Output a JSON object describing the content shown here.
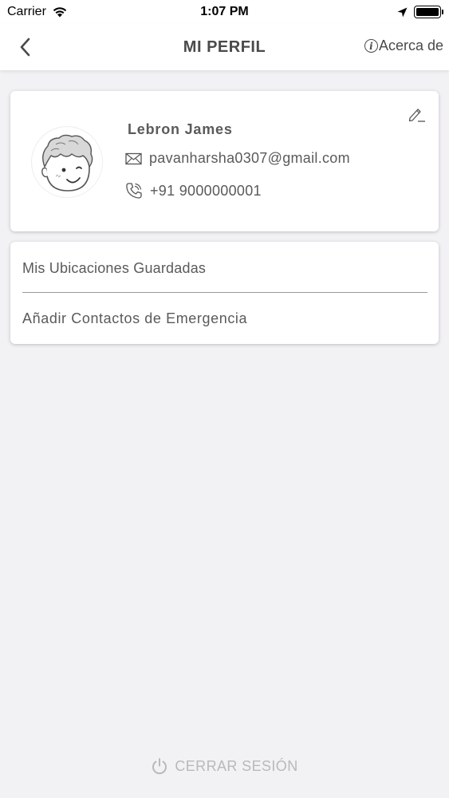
{
  "status_bar": {
    "carrier": "Carrier",
    "time": "1:07 PM"
  },
  "nav": {
    "title": "MI PERFIL",
    "about_label": "Acerca de",
    "about_icon_glyph": "i"
  },
  "profile": {
    "name": "Lebron James",
    "email": "pavanharsha0307@gmail.com",
    "phone": "+91 9000000001"
  },
  "menu": {
    "items": [
      {
        "label": "Mis Ubicaciones Guardadas"
      },
      {
        "label": "Añadir Contactos de Emergencia"
      }
    ]
  },
  "logout": {
    "label": "CERRAR SESIÓN"
  },
  "colors": {
    "background": "#f2f1f4",
    "card": "#ffffff",
    "text": "#5a5a5a",
    "logout_text": "#b9b9bd"
  },
  "icons": {
    "back": "chevron-left-icon",
    "about": "info-icon",
    "edit": "pencil-icon",
    "email": "envelope-icon",
    "phone": "phone-icon",
    "logout": "power-icon",
    "wifi": "wifi-icon",
    "location": "location-arrow-icon",
    "battery": "battery-icon"
  }
}
